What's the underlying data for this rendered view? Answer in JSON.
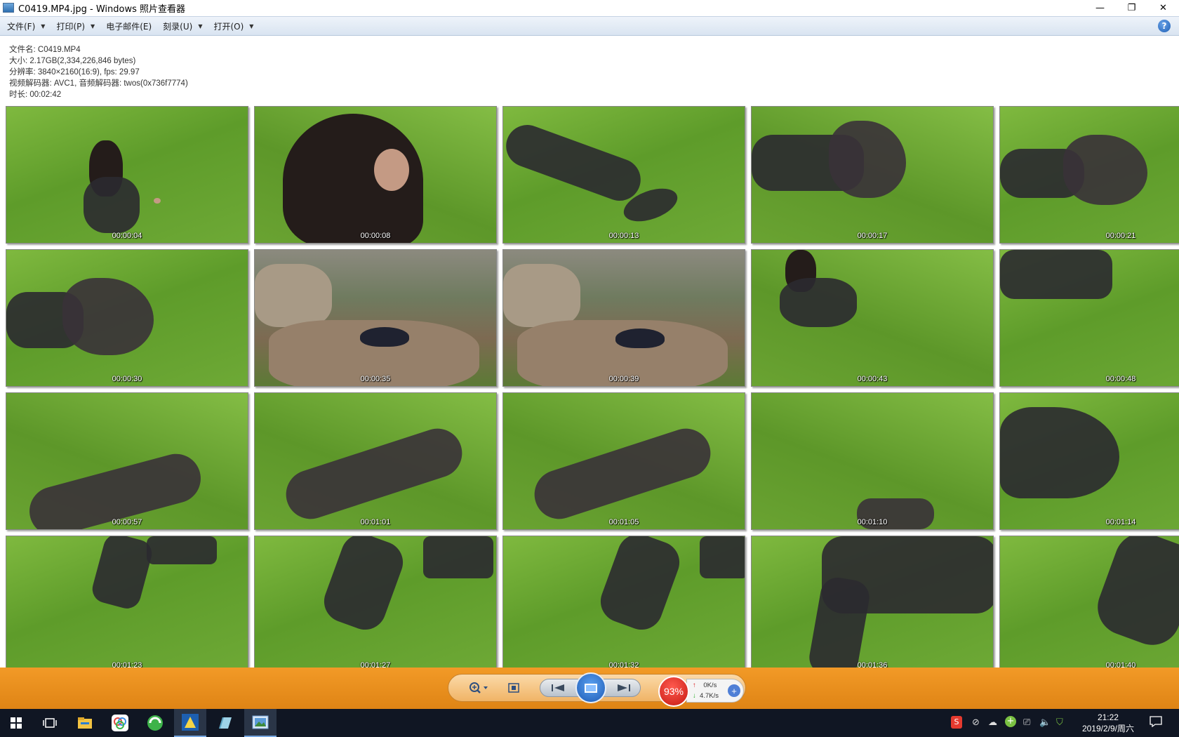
{
  "window": {
    "title": "C0419.MP4.jpg - Windows 照片查看器",
    "minimize": "—",
    "maximize": "❐",
    "close": "✕"
  },
  "menu": {
    "items": [
      {
        "label": "文件(F)",
        "has_arrow": true
      },
      {
        "label": "打印(P)",
        "has_arrow": true
      },
      {
        "label": "电子邮件(E)",
        "has_arrow": false
      },
      {
        "label": "刻录(U)",
        "has_arrow": true
      },
      {
        "label": "打开(O)",
        "has_arrow": true
      }
    ],
    "help": "?"
  },
  "info": {
    "filename": "文件名: C0419.MP4",
    "size": "大小: 2.17GB(2,334,226,846 bytes)",
    "resolution": "分辨率: 3840×2160(16:9), fps: 29.97",
    "codec": "视频解码器: AVC1, 音频解码器: twos(0x736f7774)",
    "duration": "时长: 00:02:42"
  },
  "thumbnails": [
    "00:00:04",
    "00:00:08",
    "00:00:13",
    "00:00:17",
    "00:00:21",
    "00:00:30",
    "00:00:35",
    "00:00:39",
    "00:00:43",
    "00:00:48",
    "00:00:57",
    "00:01:01",
    "00:01:05",
    "00:01:10",
    "00:01:14",
    "00:01:23",
    "00:01:27",
    "00:01:32",
    "00:01:36",
    "00:01:40"
  ],
  "toolbar": {
    "zoom_icon": "zoom-icon",
    "fit_icon": "fit-icon",
    "prev_icon": "previous-icon",
    "next_icon": "next-icon",
    "slideshow_icon": "slideshow-icon"
  },
  "network": {
    "percent": "93%",
    "up": "0K/s",
    "down": "4.7K/s"
  },
  "taskbar": {
    "clock_time": "21:22",
    "clock_date": "2019/2/9/周六"
  }
}
